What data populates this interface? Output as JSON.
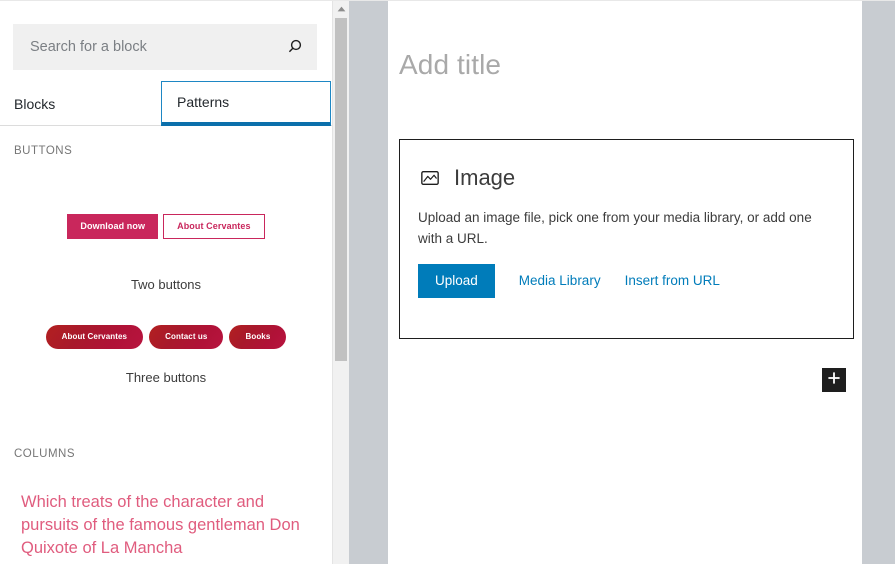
{
  "sidebar": {
    "search": {
      "placeholder": "Search for a block",
      "value": "",
      "icon": "search-icon"
    },
    "tabs": [
      {
        "label": "Blocks",
        "selected": false
      },
      {
        "label": "Patterns",
        "selected": true
      }
    ],
    "sections": [
      {
        "label": "BUTTONS",
        "patterns": [
          {
            "caption": "Two buttons",
            "buttons": [
              {
                "label": "Download now",
                "style": "filled"
              },
              {
                "label": "About Cervantes",
                "style": "outline"
              }
            ]
          },
          {
            "caption": "Three buttons",
            "buttons": [
              {
                "label": "About Cervantes",
                "style": "pill"
              },
              {
                "label": "Contact us",
                "style": "pill"
              },
              {
                "label": "Books",
                "style": "pill"
              }
            ]
          }
        ]
      },
      {
        "label": "COLUMNS",
        "patterns": [
          {
            "text": "Which treats of the character and pursuits of the famous gentleman Don Quixote of La Mancha"
          }
        ]
      }
    ],
    "scrollbar": {
      "up_arrow_icon": "chevron-up-icon"
    }
  },
  "editor": {
    "title_placeholder": "Add title",
    "image_block": {
      "icon": "image-icon",
      "title": "Image",
      "description": "Upload an image file, pick one from your media library, or add one with a URL.",
      "upload_label": "Upload",
      "media_library_label": "Media Library",
      "insert_url_label": "Insert from URL"
    },
    "appender": {
      "icon": "plus-icon",
      "label": "+"
    }
  },
  "colors": {
    "accent_blue": "#007cba",
    "tab_focus_blue": "#1e87c4",
    "pattern_crimson": "#c9275c",
    "pattern_pill_red": "#b01237",
    "columns_pink": "#e05c7e",
    "gutter_gray": "#c8ccd1",
    "appender_dark": "#1e1e1e"
  }
}
